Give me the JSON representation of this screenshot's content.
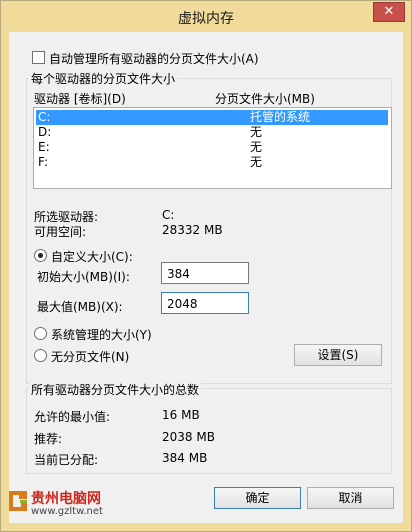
{
  "window": {
    "title": "虚拟内存",
    "close_glyph": "✕"
  },
  "auto_manage": {
    "label": "自动管理所有驱动器的分页文件大小(A)",
    "checked": false
  },
  "per_drive": {
    "group_label": "每个驱动器的分页文件大小",
    "headers": [
      "驱动器 [卷标](D)",
      "分页文件大小(MB)"
    ],
    "rows": [
      {
        "drive": "C:",
        "size": "托管的系统",
        "selected": true
      },
      {
        "drive": "D:",
        "size": "无",
        "selected": false
      },
      {
        "drive": "E:",
        "size": "无",
        "selected": false
      },
      {
        "drive": "F:",
        "size": "无",
        "selected": false
      }
    ],
    "selected_drive_label": "所选驱动器:",
    "selected_drive_value": "C:",
    "free_space_label": "可用空间:",
    "free_space_value": "28332 MB"
  },
  "custom": {
    "label": "自定义大小(C):",
    "selected": true
  },
  "initial": {
    "label": "初始大小(MB)(I):",
    "value": "384"
  },
  "maximum": {
    "label": "最大值(MB)(X):",
    "value": "2048"
  },
  "system_managed": {
    "label": "系统管理的大小(Y)"
  },
  "no_paging": {
    "label": "无分页文件(N)"
  },
  "set_button": {
    "label": "设置(S)"
  },
  "totals": {
    "group_label": "所有驱动器分页文件大小的总数",
    "min_label": "允许的最小值:",
    "min_value": "16 MB",
    "recommended_label": "推荐:",
    "recommended_value": "2038 MB",
    "current_label": "当前已分配:",
    "current_value": "384 MB"
  },
  "ok_button": {
    "label": "确定"
  },
  "cancel_button": {
    "label": "取消"
  },
  "watermark": {
    "name": "贵州电脑网",
    "url": "www.gzltw.net"
  },
  "colors": {
    "title_bar": "#f0db9a",
    "selection": "#3399ff",
    "close": "#c7514a"
  }
}
